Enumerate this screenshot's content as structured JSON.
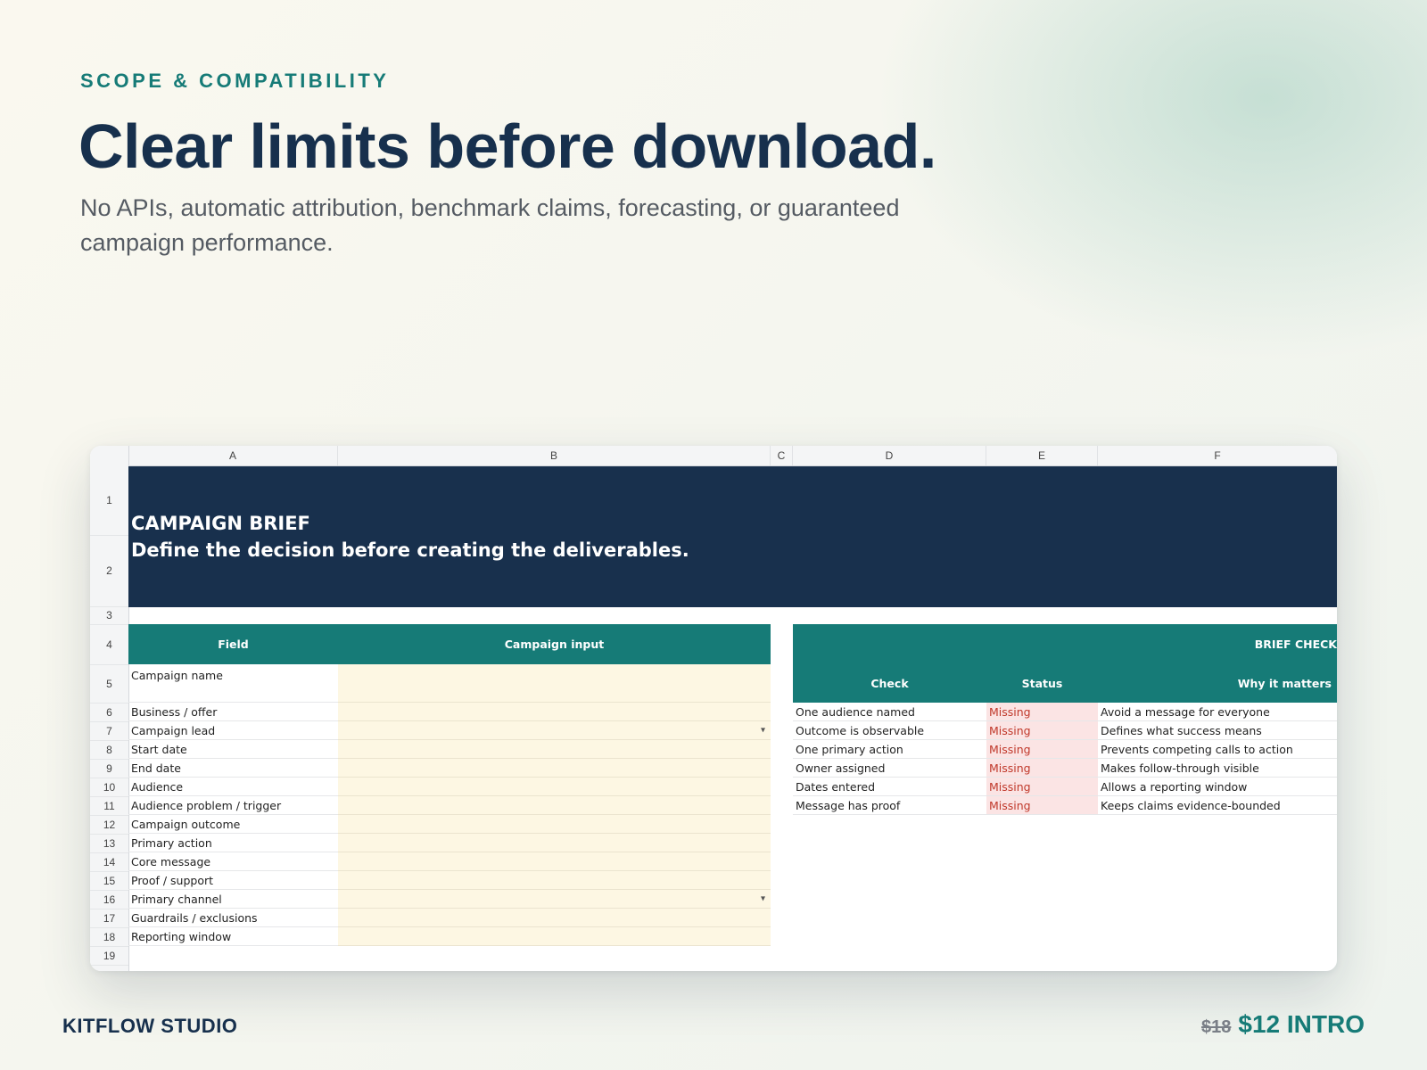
{
  "eyebrow": "SCOPE & COMPATIBILITY",
  "headline": "Clear limits before download.",
  "subhead": "No APIs, automatic attribution, benchmark claims, forecasting, or guaranteed campaign performance.",
  "sheet": {
    "columns": [
      "A",
      "B",
      "C",
      "D",
      "E",
      "F"
    ],
    "rows": [
      "1",
      "2",
      "3",
      "4",
      "5",
      "6",
      "7",
      "8",
      "9",
      "10",
      "11",
      "12",
      "13",
      "14",
      "15",
      "16",
      "17",
      "18",
      "19"
    ],
    "banner_title": "CAMPAIGN BRIEF",
    "banner_subtitle": "Define the decision before creating the deliverables.",
    "left_header": {
      "field": "Field",
      "input": "Campaign input"
    },
    "fields": [
      "Campaign name",
      "Business / offer",
      "Campaign lead",
      "Start date",
      "End date",
      "Audience",
      "Audience problem / trigger",
      "Campaign outcome",
      "Primary action",
      "Core message",
      "Proof / support",
      "Primary channel",
      "Guardrails / exclusions",
      "Reporting window"
    ],
    "dropdown_icon": "▾",
    "brief_check": {
      "title": "BRIEF CHECK",
      "headers": {
        "check": "Check",
        "status": "Status",
        "why": "Why it matters"
      },
      "rows": [
        {
          "check": "One audience named",
          "status": "Missing",
          "why": "Avoid a message for everyone"
        },
        {
          "check": "Outcome is observable",
          "status": "Missing",
          "why": "Defines what success means"
        },
        {
          "check": "One primary action",
          "status": "Missing",
          "why": "Prevents competing calls to action"
        },
        {
          "check": "Owner assigned",
          "status": "Missing",
          "why": "Makes follow-through visible"
        },
        {
          "check": "Dates entered",
          "status": "Missing",
          "why": "Allows a reporting window"
        },
        {
          "check": "Message has proof",
          "status": "Missing",
          "why": "Keeps claims evidence-bounded"
        }
      ]
    }
  },
  "footer": {
    "brand": "KITFLOW STUDIO",
    "old_price": "$18",
    "new_price": "$12 INTRO"
  },
  "colors": {
    "navy": "#18304d",
    "teal": "#167b77",
    "input_fill": "#fdf7e3",
    "missing_fill": "#fbe4e4",
    "missing_text": "#c0392b"
  }
}
